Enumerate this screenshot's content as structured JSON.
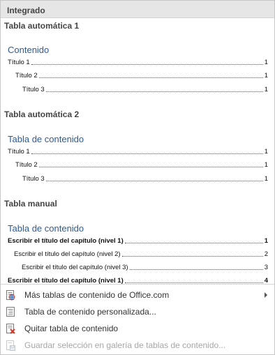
{
  "header": {
    "title": "Integrado"
  },
  "groups": [
    {
      "title": "Tabla automática 1",
      "heading": "Contenido",
      "lines": [
        {
          "text": "Título 1",
          "page": "1",
          "level": 1,
          "bold": false
        },
        {
          "text": "Título 2",
          "page": "1",
          "level": 2,
          "bold": false
        },
        {
          "text": "Título 3",
          "page": "1",
          "level": 3,
          "bold": false
        }
      ]
    },
    {
      "title": "Tabla automática 2",
      "heading": "Tabla de contenido",
      "lines": [
        {
          "text": "Título 1",
          "page": "1",
          "level": 1,
          "bold": false
        },
        {
          "text": "Título 2",
          "page": "1",
          "level": 2,
          "bold": false
        },
        {
          "text": "Título 3",
          "page": "1",
          "level": 3,
          "bold": false
        }
      ]
    },
    {
      "title": "Tabla manual",
      "heading": "Tabla de contenido",
      "lines": [
        {
          "text": "Escribir el título del capítulo (nivel 1)",
          "page": "1",
          "level": 1,
          "bold": true
        },
        {
          "text": "Escribir el título del capítulo (nivel 2)",
          "page": "2",
          "level": 2,
          "bold": false
        },
        {
          "text": "Escribir el título del capítulo (nivel 3)",
          "page": "3",
          "level": 3,
          "bold": false
        },
        {
          "text": "Escribir el título del capítulo (nivel 1)",
          "page": "4",
          "level": 1,
          "bold": true
        }
      ]
    }
  ],
  "menu": [
    {
      "label": "Más tablas de contenido de Office.com",
      "icon": "office-toc-icon",
      "submenu": true,
      "disabled": false
    },
    {
      "label": "Tabla de contenido personalizada...",
      "icon": "custom-toc-icon",
      "submenu": false,
      "disabled": false
    },
    {
      "label": "Quitar tabla de contenido",
      "icon": "remove-toc-icon",
      "submenu": false,
      "disabled": false
    },
    {
      "label": "Guardar selección en galería de tablas de contenido...",
      "icon": "save-toc-gallery-icon",
      "submenu": false,
      "disabled": true
    }
  ]
}
